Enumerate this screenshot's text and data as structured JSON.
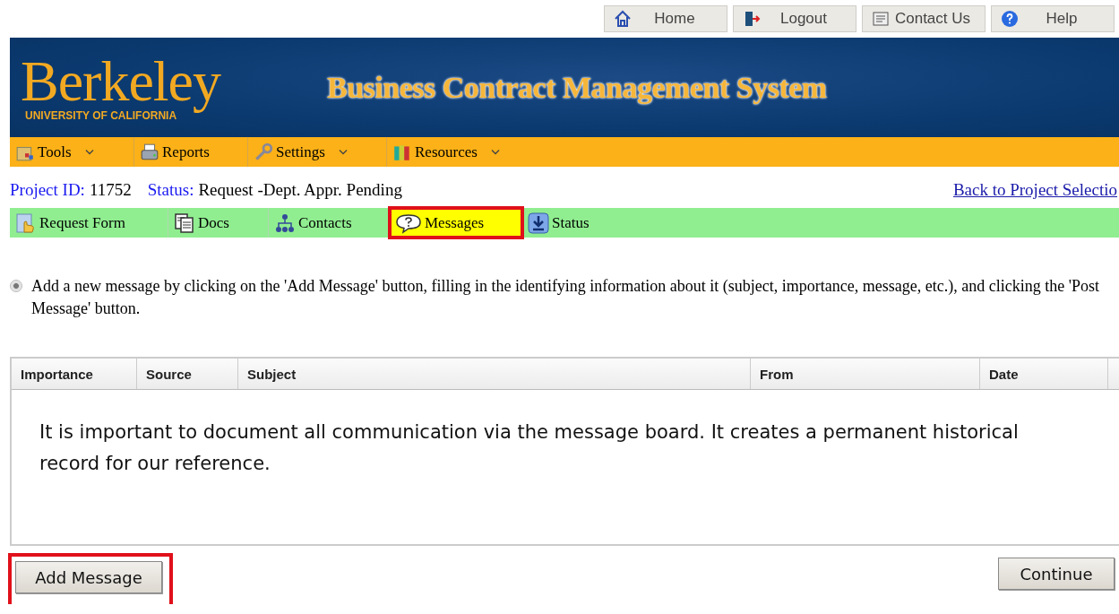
{
  "top_links": [
    {
      "label": "Home"
    },
    {
      "label": "Logout"
    },
    {
      "label": "Contact Us"
    },
    {
      "label": "Help"
    }
  ],
  "banner": {
    "logo": "Berkeley",
    "logo_sub": "UNIVERSITY OF CALIFORNIA",
    "title": "Business Contract Management System"
  },
  "menu": [
    {
      "label": "Tools",
      "dropdown": true
    },
    {
      "label": "Reports",
      "dropdown": false
    },
    {
      "label": "Settings",
      "dropdown": true
    },
    {
      "label": "Resources",
      "dropdown": true
    }
  ],
  "project": {
    "id_label": "Project ID:",
    "id": "11752",
    "status_label": "Status:",
    "status": "Request -Dept. Appr. Pending",
    "back_link": "Back to Project Selectio"
  },
  "tabs": [
    {
      "label": "Request Form",
      "selected": false,
      "highlighted": false
    },
    {
      "label": "Docs",
      "selected": false,
      "highlighted": false
    },
    {
      "label": "Contacts",
      "selected": false,
      "highlighted": false
    },
    {
      "label": "Messages",
      "selected": true,
      "highlighted": true
    },
    {
      "label": "Status",
      "selected": false,
      "highlighted": false
    }
  ],
  "instruction": "Add a new message by clicking on the 'Add Message' button, filling in the identifying information about it (subject, importance, message, etc.), and clicking the 'Post Message' button.",
  "table": {
    "columns": [
      "Importance",
      "Source",
      "Subject",
      "From",
      "Date"
    ]
  },
  "annotation": "It is important to document all communication via the message board. It creates a permanent historical record for our reference.",
  "buttons": [
    {
      "label": "Add Message",
      "highlighted": true
    },
    {
      "label": "Continue",
      "highlighted": false
    }
  ]
}
